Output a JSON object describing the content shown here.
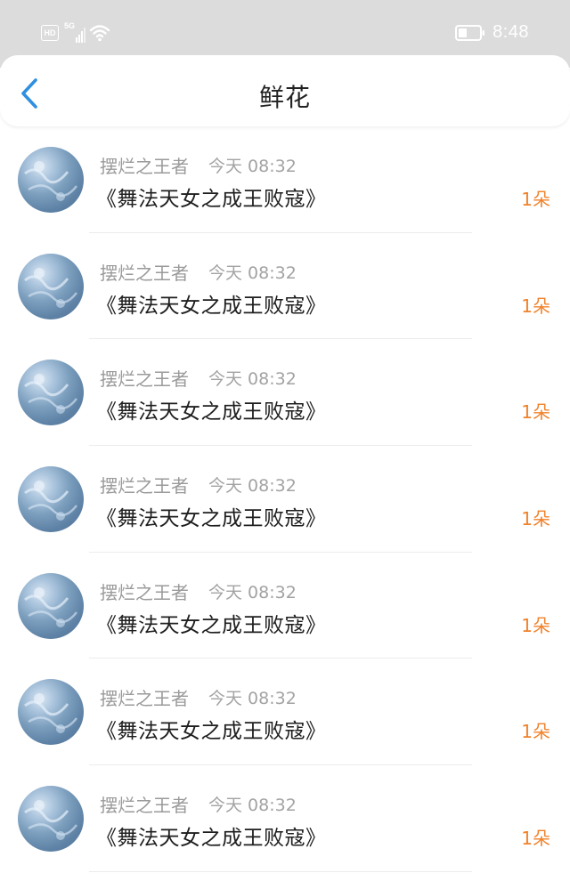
{
  "status_bar": {
    "hd_label": "HD",
    "network_label": "5G",
    "time": "8:48",
    "icons": [
      "hd-icon",
      "signal-icon",
      "wifi-icon",
      "battery-icon"
    ]
  },
  "header": {
    "back_icon": "chevron-left-icon",
    "title": "鲜花"
  },
  "colors": {
    "accent": "#2f8fe0",
    "count": "#f0822b",
    "status_bar_bg": "#dcdcdc"
  },
  "items": [
    {
      "user": "摆烂之王者",
      "time": "今天 08:32",
      "book": "《舞法天女之成王败寇》",
      "count": "1朵"
    },
    {
      "user": "摆烂之王者",
      "time": "今天 08:32",
      "book": "《舞法天女之成王败寇》",
      "count": "1朵"
    },
    {
      "user": "摆烂之王者",
      "time": "今天 08:32",
      "book": "《舞法天女之成王败寇》",
      "count": "1朵"
    },
    {
      "user": "摆烂之王者",
      "time": "今天 08:32",
      "book": "《舞法天女之成王败寇》",
      "count": "1朵"
    },
    {
      "user": "摆烂之王者",
      "time": "今天 08:32",
      "book": "《舞法天女之成王败寇》",
      "count": "1朵"
    },
    {
      "user": "摆烂之王者",
      "time": "今天 08:32",
      "book": "《舞法天女之成王败寇》",
      "count": "1朵"
    },
    {
      "user": "摆烂之王者",
      "time": "今天 08:32",
      "book": "《舞法天女之成王败寇》",
      "count": "1朵"
    }
  ]
}
